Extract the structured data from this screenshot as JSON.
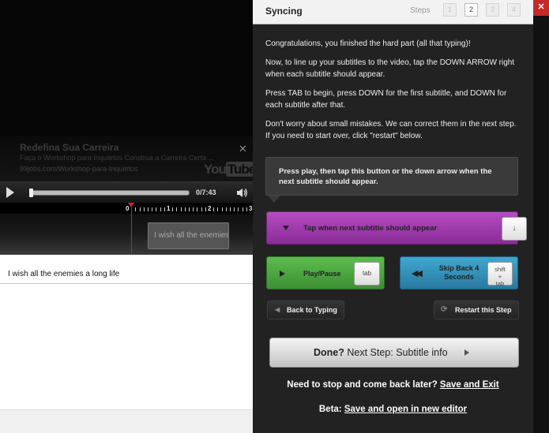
{
  "video": {
    "ad_title": "Redefina Sua Carreira",
    "ad_description": "Faça o Workshop para Inquietos Construa a Carreira Certa ...",
    "ad_url": "99jobs.com/Workshop-para-Inquietos",
    "ad_close_glyph": "✕",
    "logo_you": "You",
    "logo_tube": "Tube",
    "time": "0/7:43",
    "progress": 0
  },
  "timeline": {
    "marks": [
      "0",
      "1",
      "2",
      "3"
    ],
    "subtitle_block_text": "I wish all the enemies a long life"
  },
  "subtitles": {
    "rows": [
      "I wish all the enemies a long life"
    ]
  },
  "panel": {
    "title": "Syncing",
    "steps_label": "Steps",
    "steps": [
      "1",
      "2",
      "3",
      "4"
    ],
    "active_step": "2",
    "instructions": [
      "Congratulations, you finished the hard part (all that typing)!",
      "Now, to line up your subtitles to the video, tap the DOWN ARROW right when each subtitle should appear.",
      "Press TAB to begin, press DOWN for the first subtitle, and DOWN for each subtitle after that.",
      "Don't worry about small mistakes. We can correct them in the next step. If you need to start over, click \"restart\" below."
    ],
    "tooltip": "Press play, then tap this button or the down arrow when the next subtitle should appear.",
    "tap_button": {
      "label": "Tap when next subtitle should appear",
      "key": "↓"
    },
    "play_pause_button": {
      "label": "Play/Pause",
      "key": "tab"
    },
    "skip_back_button": {
      "label": "Skip Back 4 Seconds",
      "key_line1": "shift",
      "key_line2": "+",
      "key_line3": "tab"
    },
    "back_button": {
      "label": "Back to Typing"
    },
    "restart_button": {
      "label": "Restart this Step"
    },
    "done_button": {
      "bold": "Done?",
      "rest": " Next Step: Subtitle info"
    },
    "stop_text": "Need to stop and come back later? ",
    "stop_link": "Save and Exit",
    "beta_text": "Beta: ",
    "beta_link": "Save and open in new editor"
  },
  "close_glyph": "✕",
  "colors": {
    "tap_button": "#a03cae",
    "play_pause_button": "#4ca842",
    "skip_back_button": "#3590ba",
    "close_button": "#c82828",
    "playhead": "#c0282a"
  }
}
